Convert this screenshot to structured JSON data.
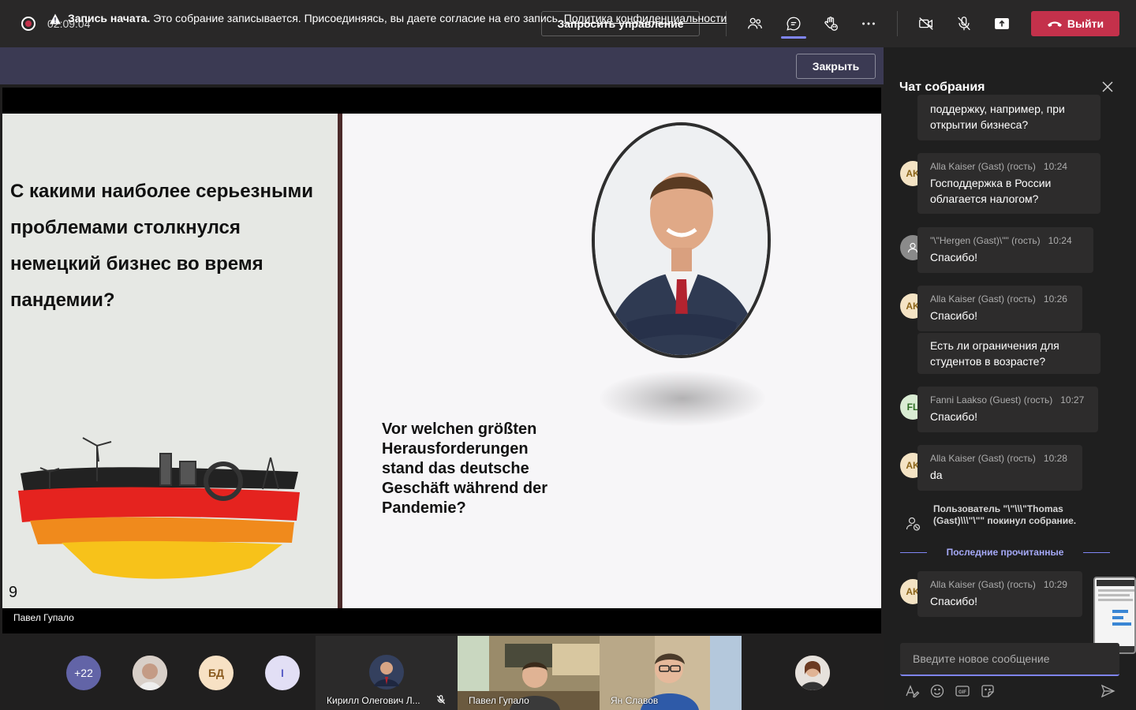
{
  "topbar": {
    "timer": "02:09:04",
    "request_control": "Запросить управление",
    "leave": "Выйти",
    "icons": [
      "participants-icon",
      "chat-icon",
      "reactions-icon",
      "more-icon",
      "camera-off-icon",
      "mic-off-icon",
      "share-icon",
      "hangup-icon"
    ]
  },
  "banner": {
    "title": "Запись начата.",
    "text": "Это собрание записывается. Присоединяясь, вы даете согласие на его запись.",
    "link": "Политика конфиденциальности",
    "close": "Закрыть"
  },
  "slide": {
    "question_ru": "С какими наиболее серьезными проблемами столкнулся немецкий бизнес во время пандемии?",
    "question_de": "Vor welchen größten Herausforderungen stand das deutsche Geschäft während der Pandemie?",
    "page_number": "9",
    "speaker": "Павел Гупало"
  },
  "participants": {
    "overflow": "+22",
    "initials_bd": "БД",
    "initials_i": "I",
    "tiles": [
      {
        "name": "Кирилл Олегович Л..."
      },
      {
        "name": "Павел Гупало"
      },
      {
        "name": "Ян Славов"
      }
    ]
  },
  "chat": {
    "title": "Чат собрания",
    "messages": [
      {
        "author": "",
        "time": "",
        "text": "поддержку, например, при открытии бизнеса?"
      },
      {
        "initials": "AK",
        "author": "Alla Kaiser (Gast) (гость)",
        "time": "10:24",
        "text": "Господдержка в России облагается налогом?"
      },
      {
        "initials": "",
        "author": "\"\\\"Hergen (Gast)\\\"\" (гость)",
        "time": "10:24",
        "text": "Спасибо!"
      },
      {
        "initials": "AK",
        "author": "Alla Kaiser (Gast) (гость)",
        "time": "10:26",
        "text": "Спасибо!"
      },
      {
        "author": "",
        "time": "",
        "text": "Есть ли ограничения для студентов в возрасте?"
      },
      {
        "initials": "FL",
        "author": "Fanni Laakso (Guest) (гость)",
        "time": "10:27",
        "text": "Спасибо!"
      },
      {
        "initials": "AK",
        "author": "Alla Kaiser (Gast) (гость)",
        "time": "10:28",
        "text": "da"
      },
      {
        "initials": "AK",
        "author": "Alla Kaiser (Gast) (гость)",
        "time": "10:29",
        "text": "Спасибо!"
      }
    ],
    "system": "Пользователь \"\\\"\\\\\\\"Thomas (Gast)\\\\\\\"\\\"\" покинул собрание.",
    "last_read": "Последние прочитанные",
    "input_placeholder": "Введите новое сообщение"
  },
  "colors": {
    "accent": "#7f85f5",
    "leave": "#c4314b",
    "banner": "#3b3a53"
  }
}
